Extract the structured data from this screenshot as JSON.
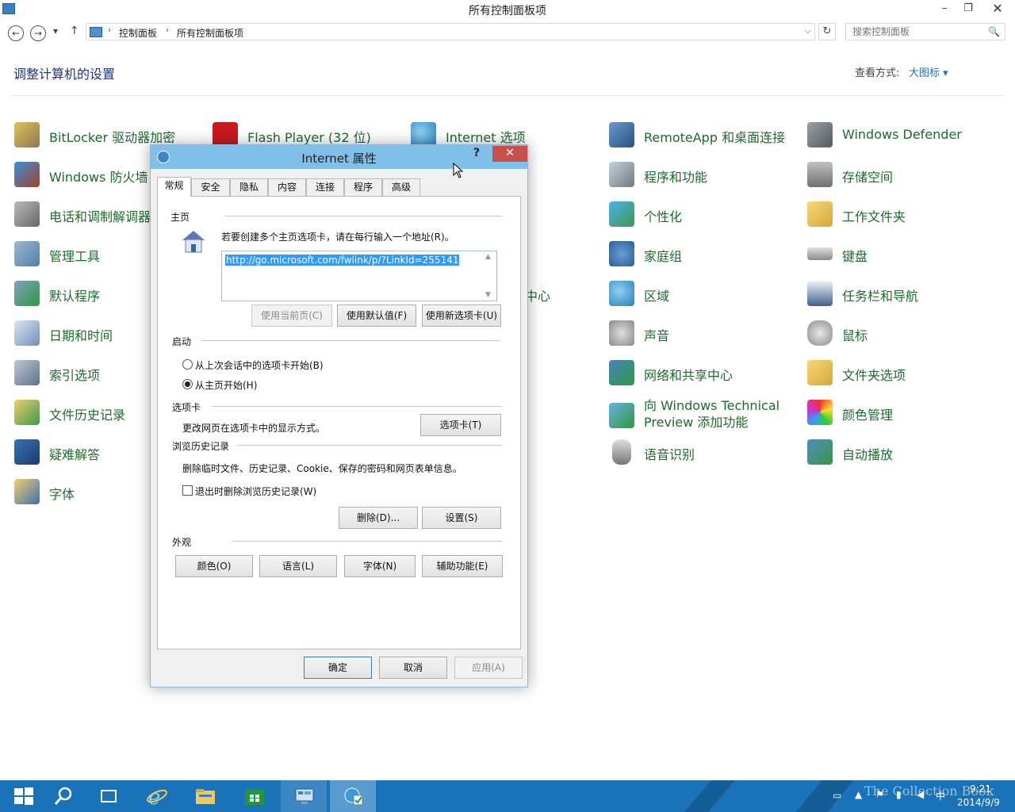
{
  "window": {
    "title": "所有控制面板项",
    "minimize": "–",
    "restore": "❐",
    "close": "✕"
  },
  "nav": {
    "back": "←",
    "forward": "→",
    "recent": "▾",
    "up": "↑",
    "refresh": "↻"
  },
  "address": {
    "crumbs": [
      "控制面板",
      "所有控制面板项"
    ],
    "sep": "›",
    "drop": "⌵"
  },
  "search": {
    "placeholder": "搜索控制面板",
    "icon": "🔍"
  },
  "header": {
    "title": "调整计算机的设置",
    "viewby_label": "查看方式:",
    "viewby_value": "大图标 ▾"
  },
  "items": {
    "c1": [
      "BitLocker 驱动器加密",
      "Windows 防火墙",
      "电话和调制解调器",
      "管理工具",
      "默认程序",
      "日期和时间",
      "索引选项",
      "文件历史记录",
      "疑难解答",
      "字体"
    ],
    "c2": [
      "Flash Player (32 位)"
    ],
    "c3": [
      "Internet 选项",
      "中心"
    ],
    "c4": [
      "RemoteApp 和桌面连接",
      "程序和功能",
      "个性化",
      "家庭组",
      "区域",
      "声音",
      "网络和共享中心",
      "向 Windows Technical Preview 添加功能",
      "语音识别"
    ],
    "c5": [
      "Windows Defender",
      "存储空间",
      "工作文件夹",
      "键盘",
      "任务栏和导航",
      "鼠标",
      "文件夹选项",
      "颜色管理",
      "自动播放"
    ]
  },
  "dialog": {
    "title": "Internet 属性",
    "help": "?",
    "close": "✕",
    "tabs": [
      "常规",
      "安全",
      "隐私",
      "内容",
      "连接",
      "程序",
      "高级"
    ],
    "home": {
      "group": "主页",
      "desc": "若要创建多个主页选项卡，请在每行输入一个地址(R)。",
      "url": "http://go.microsoft.com/fwlink/p/?LinkId=255141",
      "btn_current": "使用当前页(C)",
      "btn_default": "使用默认值(F)",
      "btn_newtab": "使用新选项卡(U)"
    },
    "startup": {
      "group": "启动",
      "opt1": "从上次会话中的选项卡开始(B)",
      "opt2": "从主页开始(H)"
    },
    "tabsgroup": {
      "group": "选项卡",
      "desc": "更改网页在选项卡中的显示方式。",
      "btn": "选项卡(T)"
    },
    "history": {
      "group": "浏览历史记录",
      "desc": "删除临时文件、历史记录、Cookie、保存的密码和网页表单信息。",
      "check": "退出时删除浏览历史记录(W)",
      "btn_delete": "删除(D)...",
      "btn_settings": "设置(S)"
    },
    "appearance": {
      "group": "外观",
      "btn_colors": "颜色(O)",
      "btn_lang": "语言(L)",
      "btn_fonts": "字体(N)",
      "btn_access": "辅助功能(E)"
    },
    "ok": "确定",
    "cancel": "取消",
    "apply": "应用(A)"
  },
  "taskbar": {
    "time": "9:21",
    "date": "2014/9/9",
    "ime": "中",
    "watermark": "The Collection Book"
  }
}
